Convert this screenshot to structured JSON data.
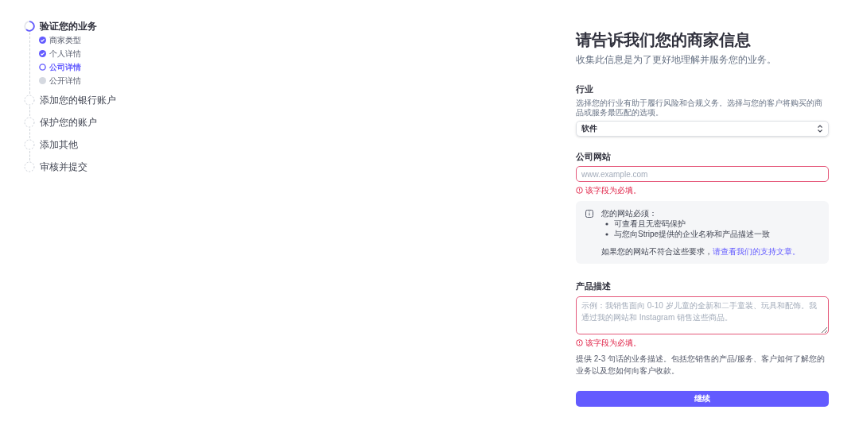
{
  "steps": [
    {
      "label": "验证您的业务",
      "kind": "current",
      "children": [
        {
          "label": "商家类型",
          "kind": "done"
        },
        {
          "label": "个人详情",
          "kind": "done"
        },
        {
          "label": "公司详情",
          "kind": "current"
        },
        {
          "label": "公开详情",
          "kind": "pending"
        }
      ]
    },
    {
      "label": "添加您的银行账户",
      "kind": "pending"
    },
    {
      "label": "保护您的账户",
      "kind": "pending"
    },
    {
      "label": "添加其他",
      "kind": "pending"
    },
    {
      "label": "审核并提交",
      "kind": "pending"
    }
  ],
  "form": {
    "title": "请告诉我们您的商家信息",
    "subtitle": "收集此信息是为了更好地理解并服务您的业务。",
    "industry": {
      "label": "行业",
      "help": "选择您的行业有助于履行风险和合规义务。选择与您的客户将购买的商品或服务最匹配的选项。",
      "value": "软件"
    },
    "website": {
      "label": "公司网站",
      "placeholder": "www.example.com",
      "error": "该字段为必填。"
    },
    "notice": {
      "title": "您的网站必须：",
      "bullets": [
        "可查看且无密码保护",
        "与您向Stripe提供的企业名称和产品描述一致"
      ],
      "text": "如果您的网站不符合这些要求，",
      "link": "请查看我们的支持文章。"
    },
    "description": {
      "label": "产品描述",
      "placeholder": "示例：我销售面向 0-10 岁儿童的全新和二手童装、玩具和配饰。我通过我的网站和 Instagram 销售这些商品。",
      "error": "该字段为必填。",
      "help": "提供 2-3 句话的业务描述。包括您销售的产品/服务、客户如何了解您的业务以及您如何向客户收款。"
    },
    "button": "继续"
  }
}
